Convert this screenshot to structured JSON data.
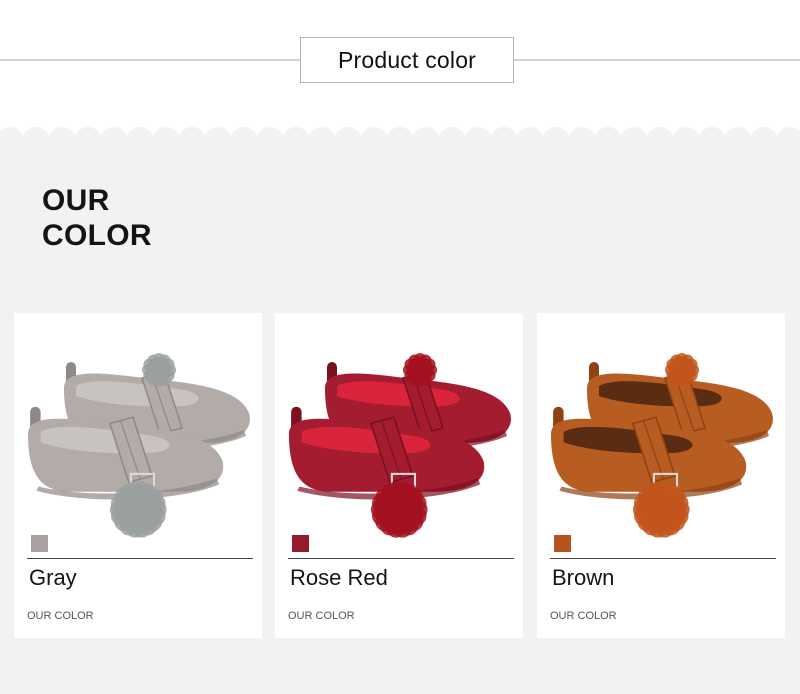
{
  "header": {
    "title": "Product color"
  },
  "section": {
    "title": "OUR\nCOLOR"
  },
  "products": [
    {
      "color_name": "Gray",
      "caption": "OUR COLOR",
      "swatch_color": "#a7a1a0",
      "shoe_color": "#b2aba8",
      "shoe_dark": "#8f8886",
      "lining_color": "#c9c3c0",
      "pompom_color": "#9aa0a0"
    },
    {
      "color_name": "Rose Red",
      "caption": "OUR COLOR",
      "swatch_color": "#941c2c",
      "shoe_color": "#a41c30",
      "shoe_dark": "#7a1020",
      "lining_color": "#d9243c",
      "pompom_color": "#a3101f"
    },
    {
      "color_name": "Brown",
      "caption": "OUR COLOR",
      "swatch_color": "#b4531a",
      "shoe_color": "#b85d22",
      "shoe_dark": "#8e4214",
      "lining_color": "#5a2d12",
      "pompom_color": "#c2551b"
    }
  ]
}
